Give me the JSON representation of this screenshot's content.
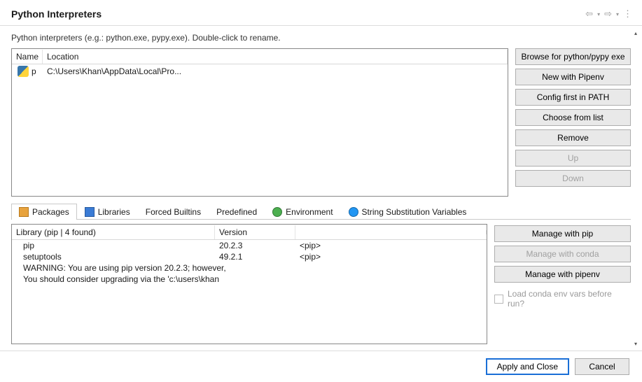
{
  "header": {
    "title": "Python Interpreters"
  },
  "description": "Python interpreters (e.g.: python.exe, pypy.exe).   Double-click to rename.",
  "interp_table": {
    "columns": {
      "name": "Name",
      "location": "Location"
    },
    "row": {
      "name": "p",
      "location": "C:\\Users\\Khan\\AppData\\Local\\Pro..."
    }
  },
  "side_buttons": {
    "browse": "Browse for python/pypy exe",
    "new_pipenv": "New with Pipenv",
    "config_path": "Config first in PATH",
    "choose_list": "Choose from list",
    "remove": "Remove",
    "up": "Up",
    "down": "Down"
  },
  "tabs": {
    "packages": "Packages",
    "libraries": "Libraries",
    "forced": "Forced Builtins",
    "predefined": "Predefined",
    "environment": "Environment",
    "string_sub": "String Substitution Variables"
  },
  "packages": {
    "lib_header": "Library (pip | 4 found)",
    "ver_header": "Version",
    "rows": [
      {
        "name": "pip",
        "version": "20.2.3",
        "source": "<pip>"
      },
      {
        "name": "setuptools",
        "version": "49.2.1",
        "source": "<pip>"
      }
    ],
    "warning_line1": "WARNING: You are using pip version 20.2.3; however,",
    "warning_line2": "You should consider upgrading via the 'c:\\users\\khan"
  },
  "manage_buttons": {
    "pip": "Manage with pip",
    "conda": "Manage with conda",
    "pipenv": "Manage with pipenv",
    "load_conda": "Load conda env vars before run?"
  },
  "footer": {
    "apply": "Apply and Close",
    "cancel": "Cancel"
  }
}
